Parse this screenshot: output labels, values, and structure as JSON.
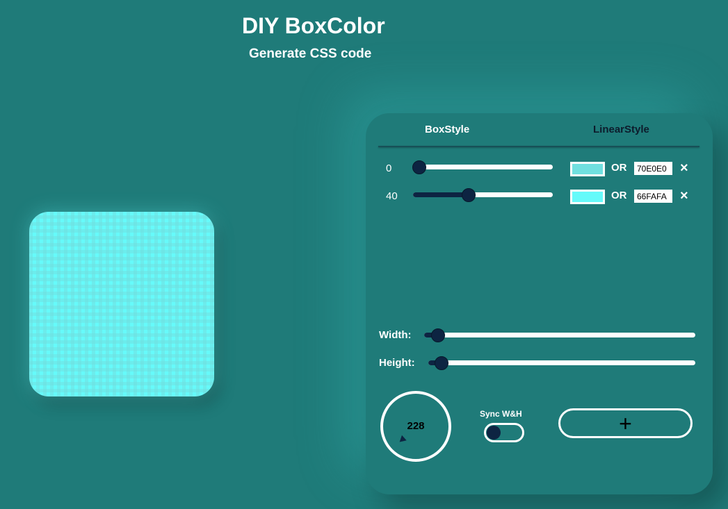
{
  "header": {
    "title": "DIY BoxColor",
    "subtitle": "Generate CSS code"
  },
  "preview": {
    "colors": [
      "#70E0E0",
      "#66FAFA"
    ]
  },
  "tabs": [
    {
      "label": "BoxStyle",
      "active": true
    },
    {
      "label": "LinearStyle",
      "active": false
    }
  ],
  "color_stops": [
    {
      "position": "0",
      "slider_fraction": 0.0,
      "swatch_color": "#70E0E0",
      "or_label": "OR",
      "hex": "70E0E0",
      "remove_icon": "×"
    },
    {
      "position": "40",
      "slider_fraction": 0.4,
      "swatch_color": "#66FAFA",
      "or_label": "OR",
      "hex": "66FAFA",
      "remove_icon": "×"
    }
  ],
  "dimensions": {
    "width_label": "Width:",
    "width_fraction": 0.05,
    "height_label": "Height:",
    "height_fraction": 0.05
  },
  "angle": {
    "value": "228"
  },
  "sync": {
    "label": "Sync W&H",
    "enabled": false
  },
  "add_button": {
    "label": "+"
  },
  "colors": {
    "background": "#1f7b79",
    "accent_dark": "#0d2442",
    "white": "#ffffff"
  }
}
